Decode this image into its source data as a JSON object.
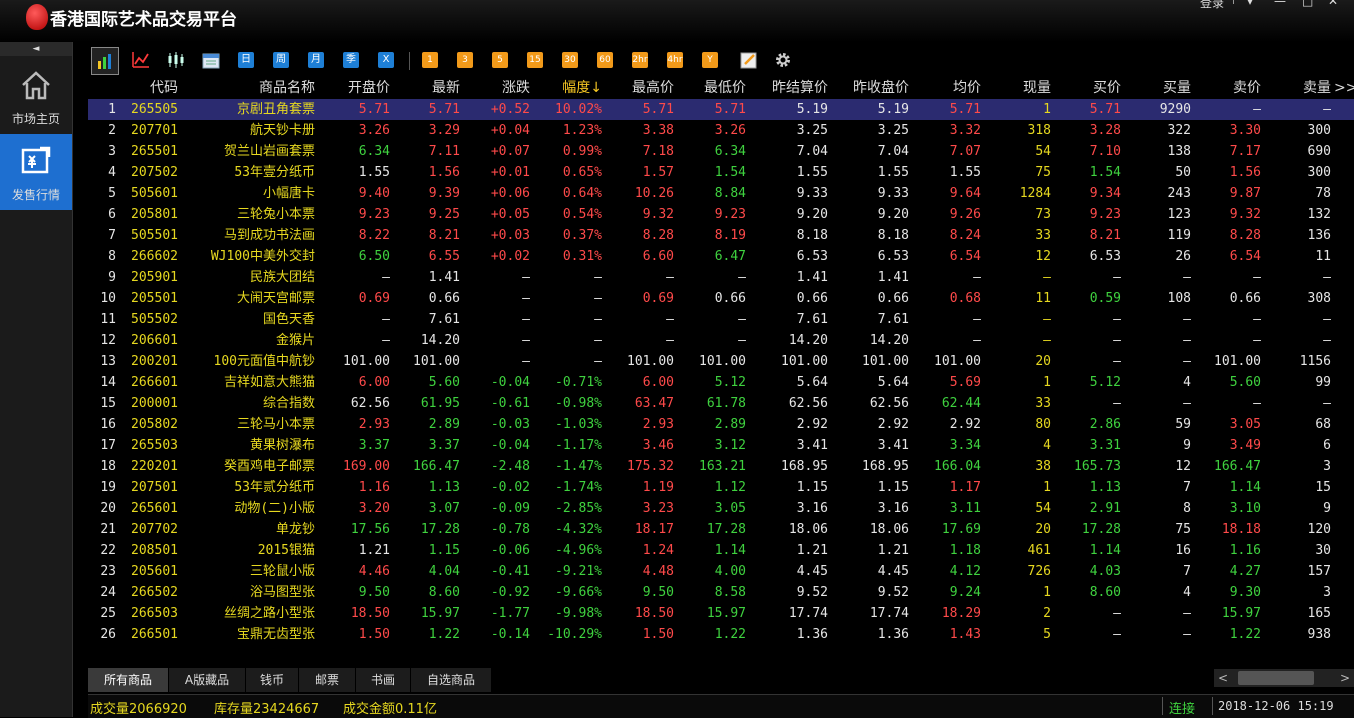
{
  "app": {
    "title": "香港国际艺术品交易平台",
    "login_label": "登录"
  },
  "sidebar": {
    "collapse": "◄",
    "items": [
      {
        "label": "市场主页",
        "icon": "home-icon"
      },
      {
        "label": "发售行情",
        "icon": "sale-chart-icon"
      }
    ]
  },
  "toolbar": {
    "period_buttons": [
      "日",
      "周",
      "月",
      "季",
      "X"
    ],
    "minute_buttons": [
      "1",
      "3",
      "5",
      "15",
      "30",
      "60",
      "2hr",
      "4hr",
      "Y"
    ]
  },
  "table": {
    "columns": [
      "代码",
      "商品名称",
      "开盘价",
      "最新",
      "涨跌",
      "幅度↓",
      "最高价",
      "最低价",
      "昨结算价",
      "昨收盘价",
      "均价",
      "现量",
      "买价",
      "买量",
      "卖价",
      "卖量"
    ],
    "more_indicator": ">>",
    "rows": [
      [
        "1",
        "265505",
        "京剧丑角套票",
        "5.71",
        "5.71",
        "+0.52",
        "10.02%",
        "5.71",
        "5.71",
        "5.19",
        "5.19",
        "5.71",
        "1",
        "5.71",
        "9290",
        "—",
        "—"
      ],
      [
        "2",
        "207701",
        "航天钞卡册",
        "3.26",
        "3.29",
        "+0.04",
        "1.23%",
        "3.38",
        "3.26",
        "3.25",
        "3.25",
        "3.32",
        "318",
        "3.28",
        "322",
        "3.30",
        "300"
      ],
      [
        "3",
        "265501",
        "贺兰山岩画套票",
        "6.34",
        "7.11",
        "+0.07",
        "0.99%",
        "7.18",
        "6.34",
        "7.04",
        "7.04",
        "7.07",
        "54",
        "7.10",
        "138",
        "7.17",
        "690"
      ],
      [
        "4",
        "207502",
        "53年壹分纸币",
        "1.55",
        "1.56",
        "+0.01",
        "0.65%",
        "1.57",
        "1.54",
        "1.55",
        "1.55",
        "1.55",
        "75",
        "1.54",
        "50",
        "1.56",
        "300"
      ],
      [
        "5",
        "505601",
        "小幅唐卡",
        "9.40",
        "9.39",
        "+0.06",
        "0.64%",
        "10.26",
        "8.84",
        "9.33",
        "9.33",
        "9.64",
        "1284",
        "9.34",
        "243",
        "9.87",
        "78"
      ],
      [
        "6",
        "205801",
        "三轮兔小本票",
        "9.23",
        "9.25",
        "+0.05",
        "0.54%",
        "9.32",
        "9.23",
        "9.20",
        "9.20",
        "9.26",
        "73",
        "9.23",
        "123",
        "9.32",
        "132"
      ],
      [
        "7",
        "505501",
        "马到成功书法画",
        "8.22",
        "8.21",
        "+0.03",
        "0.37%",
        "8.28",
        "8.19",
        "8.18",
        "8.18",
        "8.24",
        "33",
        "8.21",
        "119",
        "8.28",
        "136"
      ],
      [
        "8",
        "266602",
        "WJ100中美外交封",
        "6.50",
        "6.55",
        "+0.02",
        "0.31%",
        "6.60",
        "6.47",
        "6.53",
        "6.53",
        "6.54",
        "12",
        "6.53",
        "26",
        "6.54",
        "11"
      ],
      [
        "9",
        "205901",
        "民族大团结",
        "—",
        "1.41",
        "—",
        "—",
        "—",
        "—",
        "1.41",
        "1.41",
        "—",
        "—",
        "—",
        "—",
        "—",
        "—"
      ],
      [
        "10",
        "205501",
        "大闹天宫邮票",
        "0.69",
        "0.66",
        "—",
        "—",
        "0.69",
        "0.66",
        "0.66",
        "0.66",
        "0.68",
        "11",
        "0.59",
        "108",
        "0.66",
        "308"
      ],
      [
        "11",
        "505502",
        "国色天香",
        "—",
        "7.61",
        "—",
        "—",
        "—",
        "—",
        "7.61",
        "7.61",
        "—",
        "—",
        "—",
        "—",
        "—",
        "—"
      ],
      [
        "12",
        "206601",
        "金猴片",
        "—",
        "14.20",
        "—",
        "—",
        "—",
        "—",
        "14.20",
        "14.20",
        "—",
        "—",
        "—",
        "—",
        "—",
        "—"
      ],
      [
        "13",
        "200201",
        "100元面值中航钞",
        "101.00",
        "101.00",
        "—",
        "—",
        "101.00",
        "101.00",
        "101.00",
        "101.00",
        "101.00",
        "20",
        "—",
        "—",
        "101.00",
        "1156"
      ],
      [
        "14",
        "266601",
        "吉祥如意大熊猫",
        "6.00",
        "5.60",
        "-0.04",
        "-0.71%",
        "6.00",
        "5.12",
        "5.64",
        "5.64",
        "5.69",
        "1",
        "5.12",
        "4",
        "5.60",
        "99"
      ],
      [
        "15",
        "200001",
        "综合指数",
        "62.56",
        "61.95",
        "-0.61",
        "-0.98%",
        "63.47",
        "61.78",
        "62.56",
        "62.56",
        "62.44",
        "33",
        "—",
        "—",
        "—",
        "—"
      ],
      [
        "16",
        "205802",
        "三轮马小本票",
        "2.93",
        "2.89",
        "-0.03",
        "-1.03%",
        "2.93",
        "2.89",
        "2.92",
        "2.92",
        "2.92",
        "80",
        "2.86",
        "59",
        "3.05",
        "68"
      ],
      [
        "17",
        "265503",
        "黄果树瀑布",
        "3.37",
        "3.37",
        "-0.04",
        "-1.17%",
        "3.46",
        "3.12",
        "3.41",
        "3.41",
        "3.34",
        "4",
        "3.31",
        "9",
        "3.49",
        "6"
      ],
      [
        "18",
        "220201",
        "癸酉鸡电子邮票",
        "169.00",
        "166.47",
        "-2.48",
        "-1.47%",
        "175.32",
        "163.21",
        "168.95",
        "168.95",
        "166.04",
        "38",
        "165.73",
        "12",
        "166.47",
        "3"
      ],
      [
        "19",
        "207501",
        "53年贰分纸币",
        "1.16",
        "1.13",
        "-0.02",
        "-1.74%",
        "1.19",
        "1.12",
        "1.15",
        "1.15",
        "1.17",
        "1",
        "1.13",
        "7",
        "1.14",
        "15"
      ],
      [
        "20",
        "265601",
        "动物(二)小版",
        "3.20",
        "3.07",
        "-0.09",
        "-2.85%",
        "3.23",
        "3.05",
        "3.16",
        "3.16",
        "3.11",
        "54",
        "2.91",
        "8",
        "3.10",
        "9"
      ],
      [
        "21",
        "207702",
        "单龙钞",
        "17.56",
        "17.28",
        "-0.78",
        "-4.32%",
        "18.17",
        "17.28",
        "18.06",
        "18.06",
        "17.69",
        "20",
        "17.28",
        "75",
        "18.18",
        "120"
      ],
      [
        "22",
        "208501",
        "2015银猫",
        "1.21",
        "1.15",
        "-0.06",
        "-4.96%",
        "1.24",
        "1.14",
        "1.21",
        "1.21",
        "1.18",
        "461",
        "1.14",
        "16",
        "1.16",
        "30"
      ],
      [
        "23",
        "205601",
        "三轮鼠小版",
        "4.46",
        "4.04",
        "-0.41",
        "-9.21%",
        "4.48",
        "4.00",
        "4.45",
        "4.45",
        "4.12",
        "726",
        "4.03",
        "7",
        "4.27",
        "157"
      ],
      [
        "24",
        "266502",
        "浴马图型张",
        "9.50",
        "8.60",
        "-0.92",
        "-9.66%",
        "9.50",
        "8.58",
        "9.52",
        "9.52",
        "9.24",
        "1",
        "8.60",
        "4",
        "9.30",
        "3"
      ],
      [
        "25",
        "266503",
        "丝绸之路小型张",
        "18.50",
        "15.97",
        "-1.77",
        "-9.98%",
        "18.50",
        "15.97",
        "17.74",
        "17.74",
        "18.29",
        "2",
        "—",
        "—",
        "15.97",
        "165"
      ],
      [
        "26",
        "266501",
        "宝鼎无齿型张",
        "1.50",
        "1.22",
        "-0.14",
        "-10.29%",
        "1.50",
        "1.22",
        "1.36",
        "1.36",
        "1.43",
        "5",
        "—",
        "—",
        "1.22",
        "938"
      ]
    ]
  },
  "tabs": [
    "所有商品",
    "A版藏品",
    "钱币",
    "邮票",
    "书画",
    "自选商品"
  ],
  "status": {
    "volume": "成交量2066920",
    "inventory": "库存量23424667",
    "amount": "成交金额0.11亿",
    "connection": "连接",
    "datetime": "2018-12-06 15:19"
  },
  "colors": {
    "up": "#ff4a4a",
    "down": "#3fd23f",
    "flat": "#e6e6e6",
    "code": "#e6d820",
    "selected_row": "#2b2b70",
    "sidebar_active": "#1e6fd0"
  }
}
